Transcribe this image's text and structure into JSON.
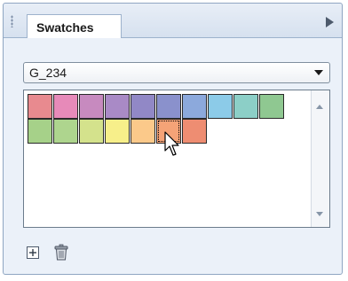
{
  "panel": {
    "tab_label": "Swatches",
    "menu_icon": "panel-menu-arrow-icon",
    "grip_icon": "panel-grip-icon"
  },
  "library_select": {
    "selected": "G_234"
  },
  "swatches": [
    {
      "color": "#e88a8f"
    },
    {
      "color": "#e78ab9"
    },
    {
      "color": "#c78abf"
    },
    {
      "color": "#a98ac6"
    },
    {
      "color": "#9188c6"
    },
    {
      "color": "#8a91cc"
    },
    {
      "color": "#8ca9dc"
    },
    {
      "color": "#8ccbe8"
    },
    {
      "color": "#8ccfc7"
    },
    {
      "color": "#8fc891"
    },
    {
      "color": "#a6d189"
    },
    {
      "color": "#aed58e"
    },
    {
      "color": "#d4e28c"
    },
    {
      "color": "#f7ef8a"
    },
    {
      "color": "#fbc98a"
    },
    {
      "color": "#f5a377",
      "selected": true
    },
    {
      "color": "#ee8d72"
    }
  ],
  "bottom_toolbar": {
    "new_icon": "new-swatch-icon",
    "delete_icon": "trash-icon"
  }
}
